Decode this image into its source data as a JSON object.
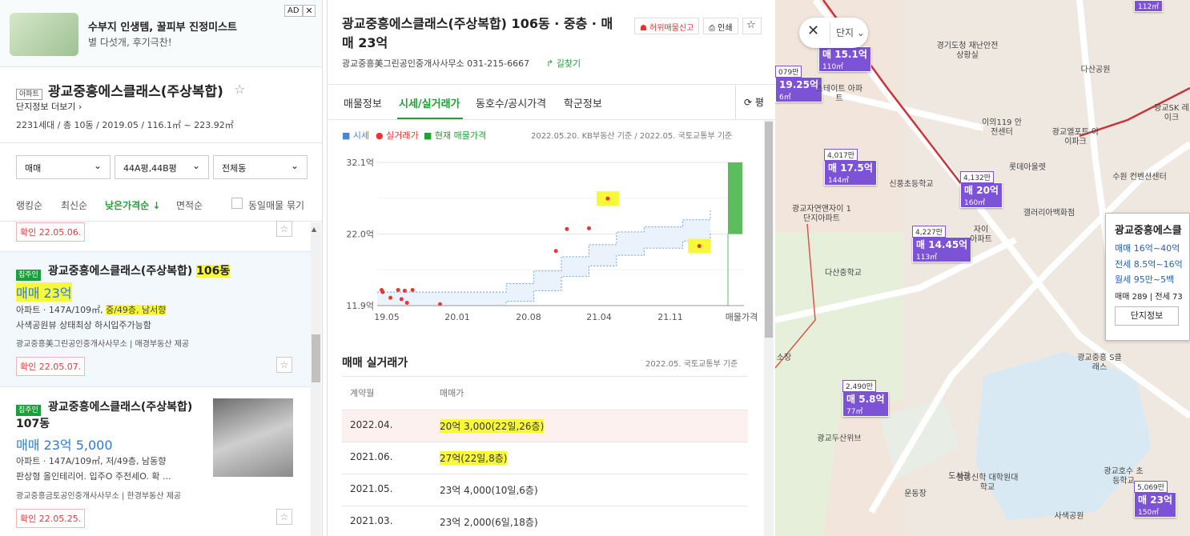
{
  "ad": {
    "tag": "AD",
    "close": "✕",
    "title": "수부지 인생템, 꿀피부 진정미스트",
    "subtitle": "별 다섯개, 후기극찬!"
  },
  "complex": {
    "badge": "아파트",
    "name": "광교중흥에스클래스(주상복합)",
    "more": "단지정보 더보기",
    "summary": "2231세대 / 총 10동 / 2019.05 / 116.1㎡ ~ 223.92㎡"
  },
  "filters": {
    "trade": "매매",
    "area": "44A평,44B평",
    "dong": "전체동"
  },
  "sort": {
    "ranking": "랭킹순",
    "latest": "최신순",
    "low_price": "낮은가격순 ↓",
    "area": "면적순",
    "group": "동일매물 묶기"
  },
  "listings": [
    {
      "confirm": "확인 22.05.06."
    },
    {
      "badge": "집주인",
      "name": "광교중흥에스클래스(주상복합)",
      "dong": "106동",
      "price": "매매 23억",
      "spec_a": "아파트 · 147A/109㎡, ",
      "spec_b": "중/49층, 남서향",
      "desc": "사색공원뷰 상태최상 하시입주가능함",
      "agent": "광교중흥美그린공인중개사사무소 | 매경부동산 제공",
      "confirm": "확인 22.05.07."
    },
    {
      "badge": "집주인",
      "name": "광교중흥에스클래스(주상복합)",
      "dong": "107동",
      "price": "매매 23억 5,000",
      "spec": "아파트 · 147A/109㎡, 저/49층, 남동향",
      "desc": "판상형 올인테리어. 입주O 주전세O. 확 ...",
      "agent": "광교중흥금토공인중개사사무소 | 한경부동산 제공",
      "confirm": "확인 22.05.25."
    }
  ],
  "detail": {
    "title": "광교중흥에스클래스(주상복합) 106동 · 중층 · 매매 23억",
    "agent": "광교중흥美그린공인중개사사무소 031-215-6667",
    "directions": "↱ 길찾기",
    "report": "☗ 허위매물신고",
    "print": "⎙ 인쇄",
    "tabs": [
      "매물정보",
      "시세/실거래가",
      "동호수/공시가격",
      "학군정보"
    ],
    "refresh": "⟳ 평"
  },
  "chart_legend": {
    "a": "■ 시세",
    "b": "● 실거래가",
    "c": "■ 현재 매물가격",
    "src": "2022.05.20. KB부동산 기준 / 2022.05. 국토교통부 기준"
  },
  "chart_data": {
    "type": "line",
    "y_ticks": [
      "32.1억",
      "22.0억",
      "11.9억"
    ],
    "x_ticks": [
      "19.05",
      "20.01",
      "20.08",
      "21.04",
      "21.11",
      "매물가격"
    ],
    "ylim": [
      11.9,
      32.1
    ],
    "band_lower": [
      [
        2019.33,
        11.9
      ],
      [
        2020.3,
        11.9
      ],
      [
        2020.5,
        12.5
      ],
      [
        2020.75,
        14.0
      ],
      [
        2021.0,
        16.0
      ],
      [
        2021.25,
        17.5
      ],
      [
        2021.5,
        19.0
      ],
      [
        2021.75,
        20.0
      ],
      [
        2022.1,
        21.0
      ],
      [
        2022.35,
        22.3
      ]
    ],
    "band_upper": [
      [
        2019.33,
        13.8
      ],
      [
        2020.3,
        13.8
      ],
      [
        2020.5,
        15.0
      ],
      [
        2020.75,
        16.8
      ],
      [
        2021.0,
        18.8
      ],
      [
        2021.25,
        20.5
      ],
      [
        2021.5,
        22.3
      ],
      [
        2021.75,
        23.0
      ],
      [
        2022.1,
        24.0
      ],
      [
        2022.35,
        25.5
      ]
    ],
    "transactions": [
      [
        2019.37,
        14.1
      ],
      [
        2019.38,
        13.8
      ],
      [
        2019.45,
        13.0
      ],
      [
        2019.52,
        14.1
      ],
      [
        2019.55,
        12.8
      ],
      [
        2019.58,
        14.0
      ],
      [
        2019.65,
        14.1
      ],
      [
        2019.6,
        12.3
      ],
      [
        2019.9,
        12.1
      ],
      [
        2020.95,
        19.6
      ],
      [
        2021.05,
        22.7
      ],
      [
        2021.25,
        22.8
      ],
      [
        2021.42,
        27.0
      ],
      [
        2022.25,
        20.3
      ]
    ],
    "listing_range": [
      22.0,
      32.1
    ]
  },
  "trades": {
    "title": "매매 실거래가",
    "src": "2022.05. 국토교통부 기준",
    "headers": [
      "계약월",
      "매매가"
    ],
    "rows": [
      {
        "month": "2022.04.",
        "price": "20억 3,000(22일,26층)"
      },
      {
        "month": "2021.06.",
        "price": "27억(22일,8층)"
      },
      {
        "month": "2021.05.",
        "price": "23억 4,000(10일,6층)"
      },
      {
        "month": "2021.03.",
        "price": "23억 2,000(6일,18층)"
      }
    ]
  },
  "map": {
    "ctl": "단지",
    "markers": [
      {
        "top": "",
        "price": "매 15.1억",
        "area": "110㎡"
      },
      {
        "top": "079만",
        "price": "19.25억",
        "area": "6㎡"
      },
      {
        "top": "4,017만",
        "price": "매 17.5억",
        "area": "144㎡"
      },
      {
        "top": "4,132만",
        "price": "매 20억",
        "area": "160㎡"
      },
      {
        "top": "4,227만",
        "price": "매 14.45억",
        "area": "113㎡"
      },
      {
        "top": "2,490만",
        "price": "매 5.8억",
        "area": "77㎡"
      },
      {
        "top": "5,069만",
        "price": "매 23억",
        "area": "150㎡"
      },
      {
        "top": "",
        "price": "",
        "area": "112㎡"
      }
    ],
    "labels": [
      "경기도청 재난안전상황실",
      "이의119 안전센터",
      "광교엘포트 아이파크",
      "롯데아울렛",
      "다산공원",
      "광교SK 레이크",
      "수원 컨벤션센터",
      "신풍초등학교",
      "광교자연앤자이 1단지아파트",
      "갤러리아백화점",
      "다산중학교",
      "광교중흥 S클래스",
      "광교두산위브",
      "도서관",
      "함동신학 대학원대학교",
      "운동장",
      "사색공원",
      "광교호수 초등학교",
      "스테이트 아파트",
      "자이 아파트",
      "소장"
    ],
    "popup": {
      "title": "광교중흥에스클",
      "l1": "매매 16억~40억",
      "l2": "전세 8.5억~16억",
      "l3": "월세 95만~5백",
      "l4a": "매매 289",
      "l4b": "| 전세 73",
      "btn": "단지정보"
    }
  }
}
